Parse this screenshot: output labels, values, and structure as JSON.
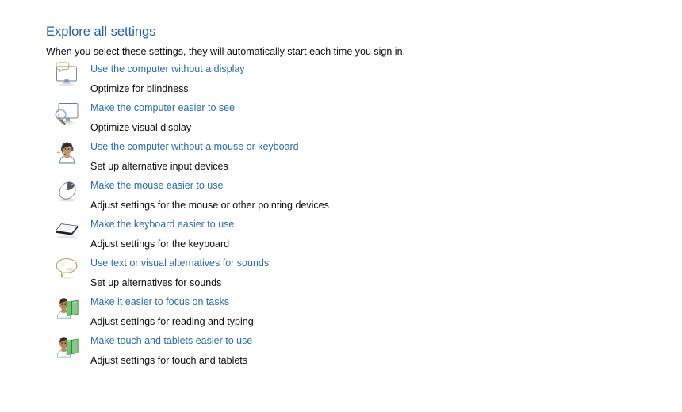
{
  "header": {
    "title": "Explore all settings",
    "subtitle": "When you select these settings, they will automatically start each time you sign in."
  },
  "colors": {
    "background": "#ffffff",
    "heading_blue": "#1f5fad",
    "link_blue": "#2a6ab0",
    "body_text": "#0b0b0b"
  },
  "settings": [
    {
      "icon": "monitor-speech-bubble-icon",
      "link": "Use the computer without a display",
      "description": "Optimize for blindness"
    },
    {
      "icon": "monitor-magnifier-icon",
      "link": "Make the computer easier to see",
      "description": "Optimize visual display"
    },
    {
      "icon": "person-headset-icon",
      "link": "Use the computer without a mouse or keyboard",
      "description": "Set up alternative input devices"
    },
    {
      "icon": "mouse-icon",
      "link": "Make the mouse easier to use",
      "description": "Adjust settings for the mouse or other pointing devices"
    },
    {
      "icon": "keyboard-icon",
      "link": "Make the keyboard easier to use",
      "description": "Adjust settings for the keyboard"
    },
    {
      "icon": "speech-bubble-icon",
      "link": "Use text or visual alternatives for sounds",
      "description": "Set up alternatives for sounds"
    },
    {
      "icon": "person-book-icon",
      "link": "Make it easier to focus on tasks",
      "description": "Adjust settings for reading and typing"
    },
    {
      "icon": "person-book-icon",
      "link": "Make touch and tablets easier to use",
      "description": "Adjust settings for touch and tablets"
    }
  ]
}
